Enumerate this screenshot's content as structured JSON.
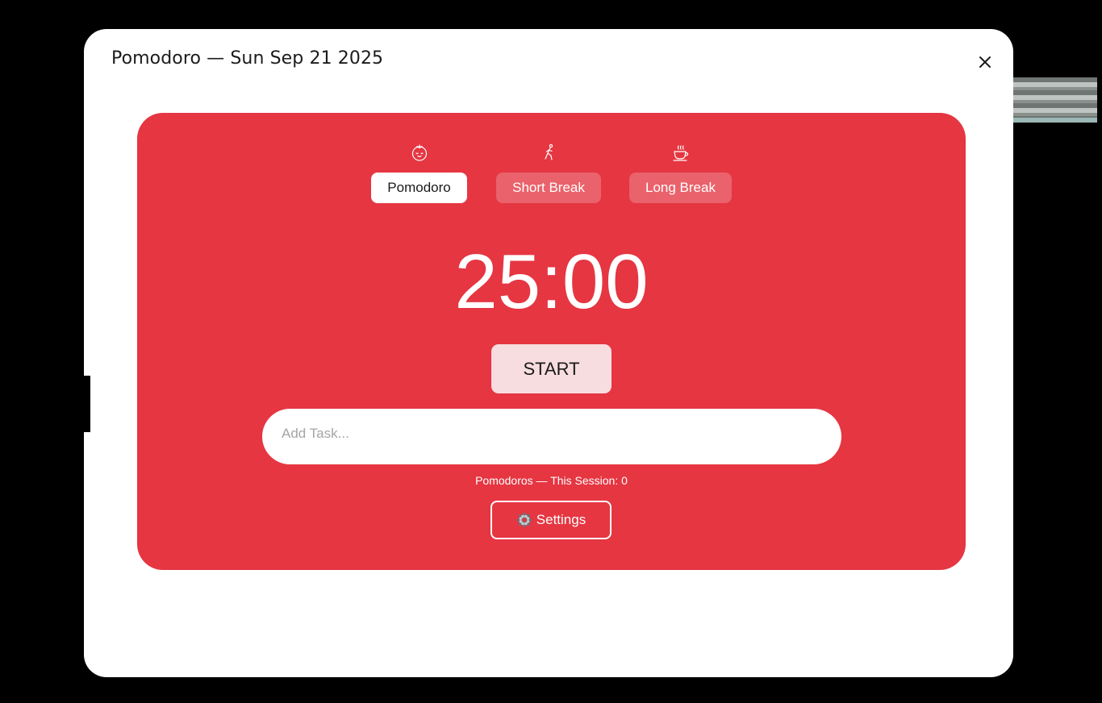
{
  "window": {
    "title": "Pomodoro — Sun Sep 21 2025",
    "close_icon": "close-icon"
  },
  "colors": {
    "panel_bg": "#e53642",
    "start_button_bg": "#f8dde0",
    "dialog_bg": "#ffffff"
  },
  "modes": [
    {
      "label": "Pomodoro",
      "icon": "tomato-icon",
      "active": true
    },
    {
      "label": "Short Break",
      "icon": "runner-icon",
      "active": false
    },
    {
      "label": "Long Break",
      "icon": "coffee-cup-icon",
      "active": false
    }
  ],
  "timer": {
    "display": "25:00"
  },
  "start_button": {
    "label": "START"
  },
  "task_input": {
    "placeholder": "Add Task...",
    "value": ""
  },
  "session": {
    "text": "Pomodoros — This Session: 0"
  },
  "settings_button": {
    "label": "Settings",
    "icon": "gear-icon"
  }
}
